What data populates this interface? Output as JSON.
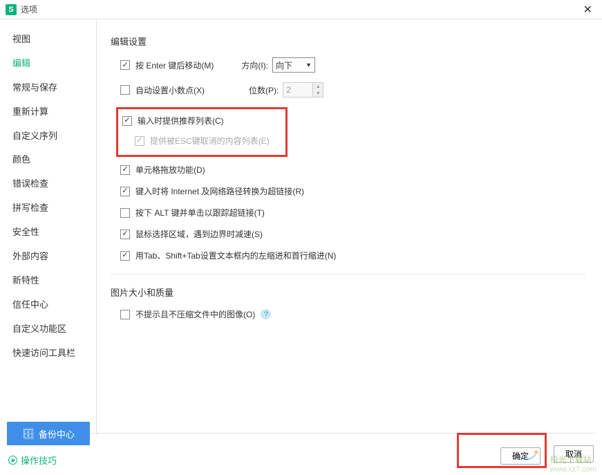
{
  "titlebar": {
    "title": "选项"
  },
  "sidebar": {
    "items": [
      {
        "label": "视图"
      },
      {
        "label": "编辑"
      },
      {
        "label": "常规与保存"
      },
      {
        "label": "重新计算"
      },
      {
        "label": "自定义序列"
      },
      {
        "label": "颜色"
      },
      {
        "label": "错误检查"
      },
      {
        "label": "拼写检查"
      },
      {
        "label": "安全性"
      },
      {
        "label": "外部内容"
      },
      {
        "label": "新特性"
      },
      {
        "label": "信任中心"
      },
      {
        "label": "自定义功能区"
      },
      {
        "label": "快速访问工具栏"
      }
    ],
    "activeIndex": 1
  },
  "edit": {
    "section_title": "编辑设置",
    "enter_move": {
      "label": "按 Enter 键后移动(M)",
      "checked": true
    },
    "direction_label": "方向(I):",
    "direction_value": "向下",
    "auto_decimal": {
      "label": "自动设置小数点(X)",
      "checked": false
    },
    "places_label": "位数(P):",
    "places_value": "2",
    "suggest_list": {
      "label": "输入时提供推荐列表(C)",
      "checked": true
    },
    "esc_list": {
      "label": "提供被ESC键取消的内容列表(E)",
      "checked": true,
      "disabled": true
    },
    "cell_drag": {
      "label": "单元格拖放功能(D)",
      "checked": true
    },
    "hyperlink": {
      "label": "键入时将 Internet 及网络路径转换为超链接(R)",
      "checked": true
    },
    "alt_click": {
      "label": "按下 ALT 键并单击以跟踪超链接(T)",
      "checked": false
    },
    "mouse_select": {
      "label": "鼠标选择区域，遇到边界时减速(S)",
      "checked": true
    },
    "tab_indent": {
      "label": "用Tab、Shift+Tab设置文本框内的左缩进和首行缩进(N)",
      "checked": true
    }
  },
  "image": {
    "section_title": "图片大小和质量",
    "no_compress": {
      "label": "不提示且不压缩文件中的图像(O)",
      "checked": false
    }
  },
  "footer": {
    "backup_label": "备份中心",
    "tips_label": "操作技巧",
    "ok_label": "确定",
    "cancel_label": "取消"
  },
  "watermark": {
    "title": "极光下载站",
    "url": "www.xz7.com"
  }
}
